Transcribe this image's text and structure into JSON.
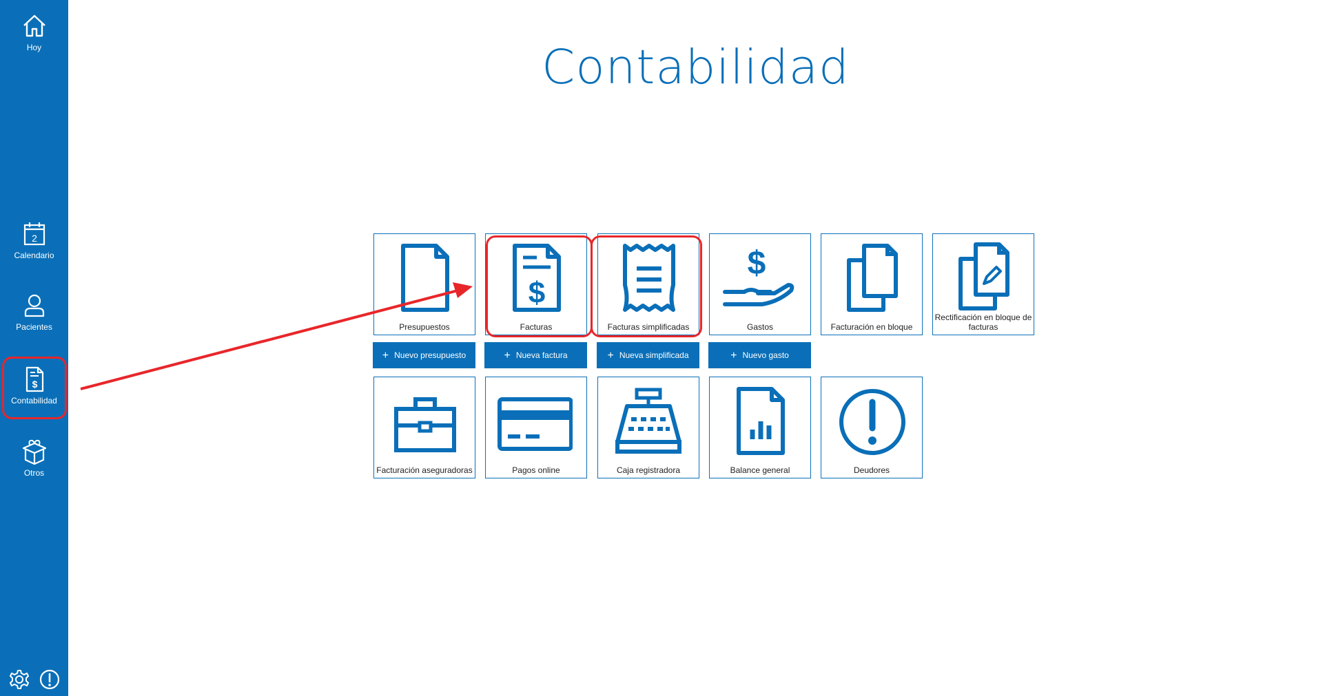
{
  "page": {
    "title": "Contabilidad"
  },
  "sidebar": {
    "items": [
      {
        "label": "Hoy",
        "icon": "home-icon"
      },
      {
        "label": "Calendario",
        "icon": "calendar-icon",
        "calendar_day": "2"
      },
      {
        "label": "Pacientes",
        "icon": "person-icon"
      },
      {
        "label": "Contabilidad",
        "icon": "invoice-dollar-icon",
        "active": true
      },
      {
        "label": "Otros",
        "icon": "gift-box-icon"
      }
    ],
    "bottom": [
      {
        "icon": "gear-icon"
      },
      {
        "icon": "alert-circle-icon"
      }
    ]
  },
  "tiles": {
    "row1": [
      {
        "label": "Presupuestos",
        "icon": "document-icon"
      },
      {
        "label": "Facturas",
        "icon": "invoice-dollar-icon"
      },
      {
        "label": "Facturas simplificadas",
        "icon": "receipt-icon"
      },
      {
        "label": "Gastos",
        "icon": "hand-dollar-icon"
      },
      {
        "label": "Facturación en bloque",
        "icon": "documents-stack-icon"
      },
      {
        "label": "Rectificación en bloque de facturas",
        "icon": "documents-edit-icon"
      }
    ],
    "row2": [
      {
        "label": "Facturación aseguradoras",
        "icon": "briefcase-icon"
      },
      {
        "label": "Pagos online",
        "icon": "credit-card-icon"
      },
      {
        "label": "Caja registradora",
        "icon": "cash-register-icon"
      },
      {
        "label": "Balance general",
        "icon": "report-chart-icon"
      },
      {
        "label": "Deudores",
        "icon": "alert-circle-icon"
      }
    ]
  },
  "actions": [
    {
      "label": "Nuevo presupuesto"
    },
    {
      "label": "Nueva factura"
    },
    {
      "label": "Nueva simplificada"
    },
    {
      "label": "Nuevo gasto"
    }
  ],
  "colors": {
    "brand": "#0a6fb8",
    "highlight": "#e8262a"
  }
}
